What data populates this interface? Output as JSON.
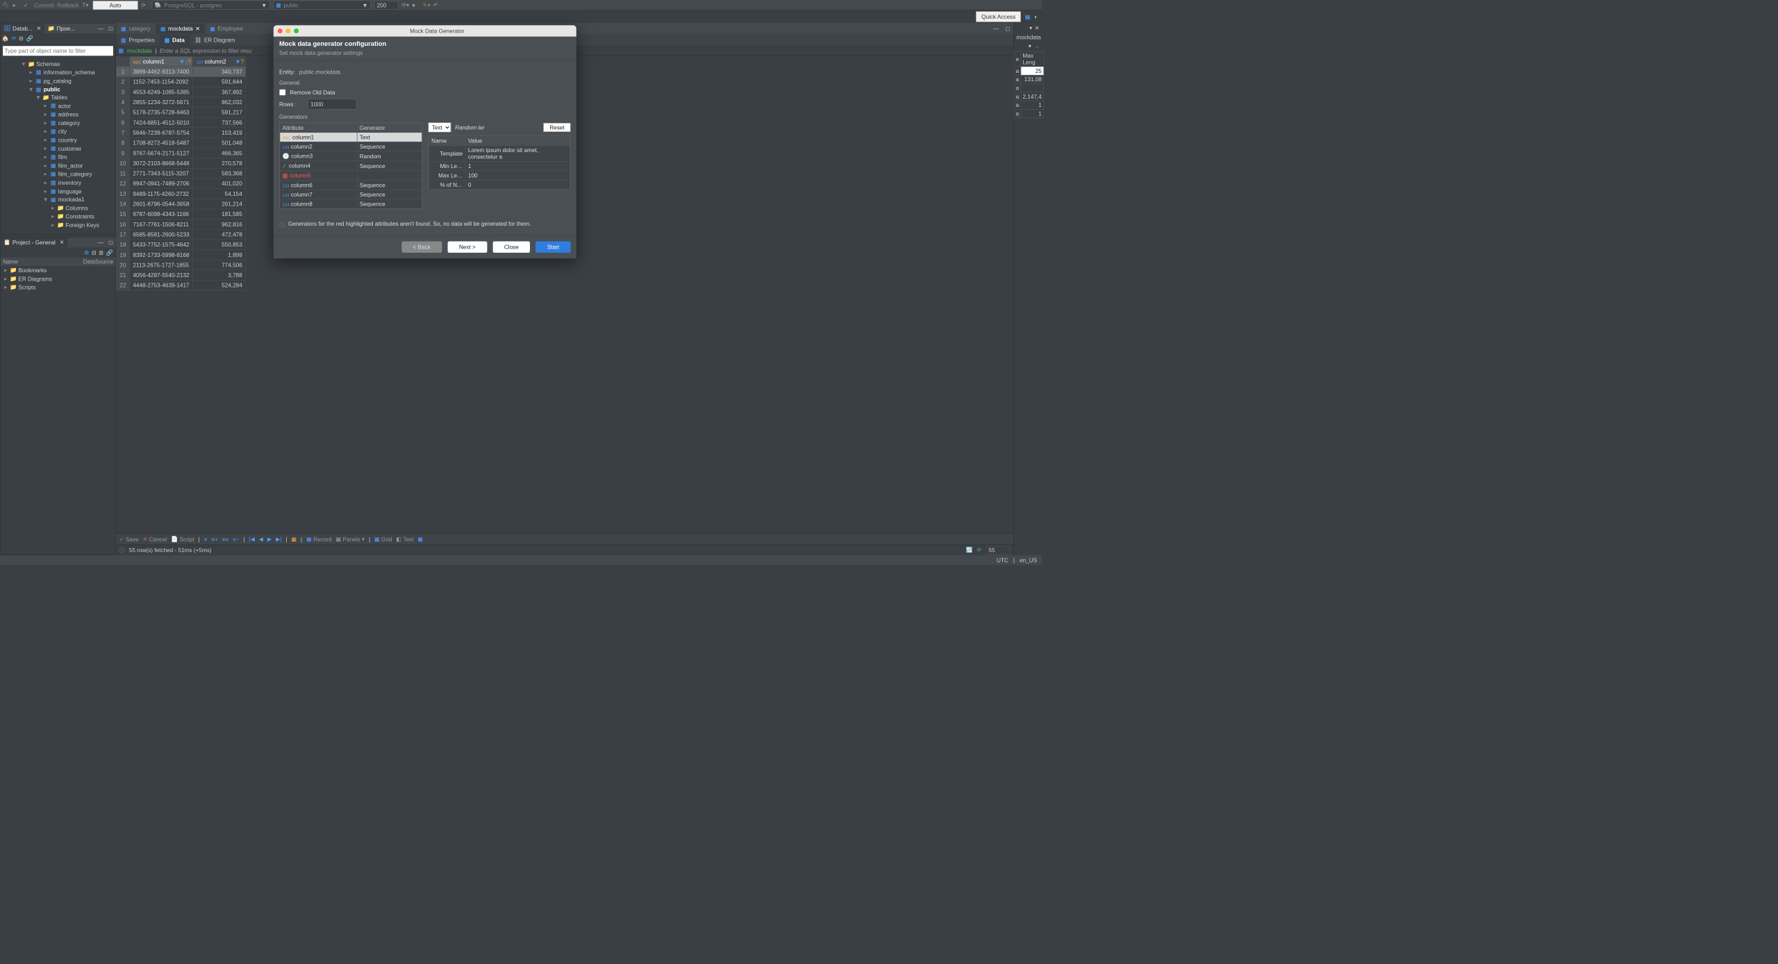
{
  "topbar": {
    "commit": "Commit",
    "rollback": "Rollback",
    "auto": "Auto",
    "conn": "PostgreSQL - postgres",
    "schema": "public",
    "limit": "200"
  },
  "quickaccess": "Quick Access",
  "leftTabs": {
    "db": "Datab...",
    "proj": "Прое..."
  },
  "filter_placeholder": "Type part of object name to filter",
  "tree": {
    "schemas": "Schemas",
    "info": "information_schema",
    "pgcat": "pg_catalog",
    "public": "public",
    "tables": "Tables",
    "rows": [
      "actor",
      "address",
      "category",
      "city",
      "country",
      "customer",
      "film",
      "film_actor",
      "film_category",
      "inventory",
      "language",
      "mockada1"
    ],
    "mock_children": [
      "Columns",
      "Constraints",
      "Foreign Keys"
    ]
  },
  "project": {
    "title": "Project - General",
    "name_hdr": "Name",
    "ds_hdr": "DataSource",
    "items": [
      "Bookmarks",
      "ER Diagrams",
      "Scripts"
    ]
  },
  "editor": {
    "tabs": [
      "category",
      "mockdata",
      "Employee"
    ],
    "subtabs": {
      "props": "Properties",
      "data": "Data",
      "er": "ER Diagram"
    },
    "entity": "mockdata",
    "filter_hint": "Enter a SQL expression to filter resu",
    "col1": "column1",
    "col2": "column2",
    "rows": [
      [
        "3899-4462-9313-7400",
        "340,737"
      ],
      [
        "1152-7453-1154-2092",
        "591,644"
      ],
      [
        "4553-6249-1085-5385",
        "367,892"
      ],
      [
        "2855-1234-3272-5671",
        "862,032"
      ],
      [
        "5178-2735-5728-6463",
        "591,217"
      ],
      [
        "7424-6851-4512-5010",
        "737,566"
      ],
      [
        "5646-7239-6787-5754",
        "153,419"
      ],
      [
        "1708-8272-4518-5487",
        "501,048"
      ],
      [
        "9767-5674-2171-5127",
        "466,365"
      ],
      [
        "3072-2103-8668-5448",
        "270,578"
      ],
      [
        "2771-7343-5115-3207",
        "583,368"
      ],
      [
        "9947-0941-7489-2706",
        "401,020"
      ],
      [
        "9489-1175-4260-2732",
        "54,154"
      ],
      [
        "2601-8796-0544-3658",
        "261,214"
      ],
      [
        "9787-6098-4343-1166",
        "181,585"
      ],
      [
        "7167-7761-1506-8211",
        "962,816"
      ],
      [
        "6585-8581-2600-5233",
        "472,478"
      ],
      [
        "5433-7752-1575-4642",
        "550,853"
      ],
      [
        "8392-1733-5998-8168",
        "1,899"
      ],
      [
        "2113-2675-1727-1855",
        "774,506"
      ],
      [
        "4056-4297-5540-2132",
        "3,788"
      ],
      [
        "4448-2753-4639-1417",
        "524,284"
      ]
    ],
    "toolbar": {
      "save": "Save",
      "cancel": "Cancel",
      "script": "Script",
      "record": "Record",
      "panels": "Panels",
      "grid": "Grid",
      "text": "Text"
    },
    "status": {
      "fetch": "55 row(s) fetched - 51ms (+5ms)",
      "count": "55"
    }
  },
  "rightpeek": {
    "title": "mockdata",
    "le": "e",
    "maxlen": "Max Leng",
    "v25": "25",
    "v131": "131,08",
    "va": "a",
    "v214": "2,147,4",
    "v1": "1"
  },
  "dialog": {
    "title": "Mock Data Generator",
    "heading": "Mock data generator configuration",
    "subhead": "Set mock data generator settings",
    "entity_lbl": "Entity:",
    "entity": "public.mockdata",
    "general": "General",
    "remove": "Remove Old Data",
    "rows_lbl": "Rows :",
    "rows_val": "1000",
    "generators": "Generators",
    "attr_hdr": "Attribute",
    "gen_hdr": "Generator",
    "attrs": [
      {
        "name": "column1",
        "gen": "Text",
        "ic": "ABC"
      },
      {
        "name": "column2",
        "gen": "Sequence",
        "ic": "123"
      },
      {
        "name": "column3",
        "gen": "Random",
        "ic": "clock"
      },
      {
        "name": "column4",
        "gen": "Sequence",
        "ic": "check"
      },
      {
        "name": "column5",
        "gen": "",
        "ic": "x",
        "missing": true
      },
      {
        "name": "column6",
        "gen": "Sequence",
        "ic": "123"
      },
      {
        "name": "column7",
        "gen": "Sequence",
        "ic": "123"
      },
      {
        "name": "column8",
        "gen": "Sequence",
        "ic": "123"
      }
    ],
    "type_sel": "Text",
    "random_lbl": "Random ler",
    "reset": "Reset",
    "prop_hdr_name": "Name",
    "prop_hdr_val": "Value",
    "props": [
      {
        "n": "Template",
        "v": "Lorem ipsum dolor sit amet, consectetur a"
      },
      {
        "n": "Min Le…",
        "v": "1"
      },
      {
        "n": "Max Le…",
        "v": "100"
      },
      {
        "n": "% of N…",
        "v": "0"
      }
    ],
    "info": "Generators for the red highlighted attributes aren't found. So, no data will be generated for them.",
    "back": "< Back",
    "next": "Next >",
    "close": "Close",
    "start": "Start"
  },
  "bottom": {
    "utc": "UTC",
    "locale": "en_US"
  }
}
